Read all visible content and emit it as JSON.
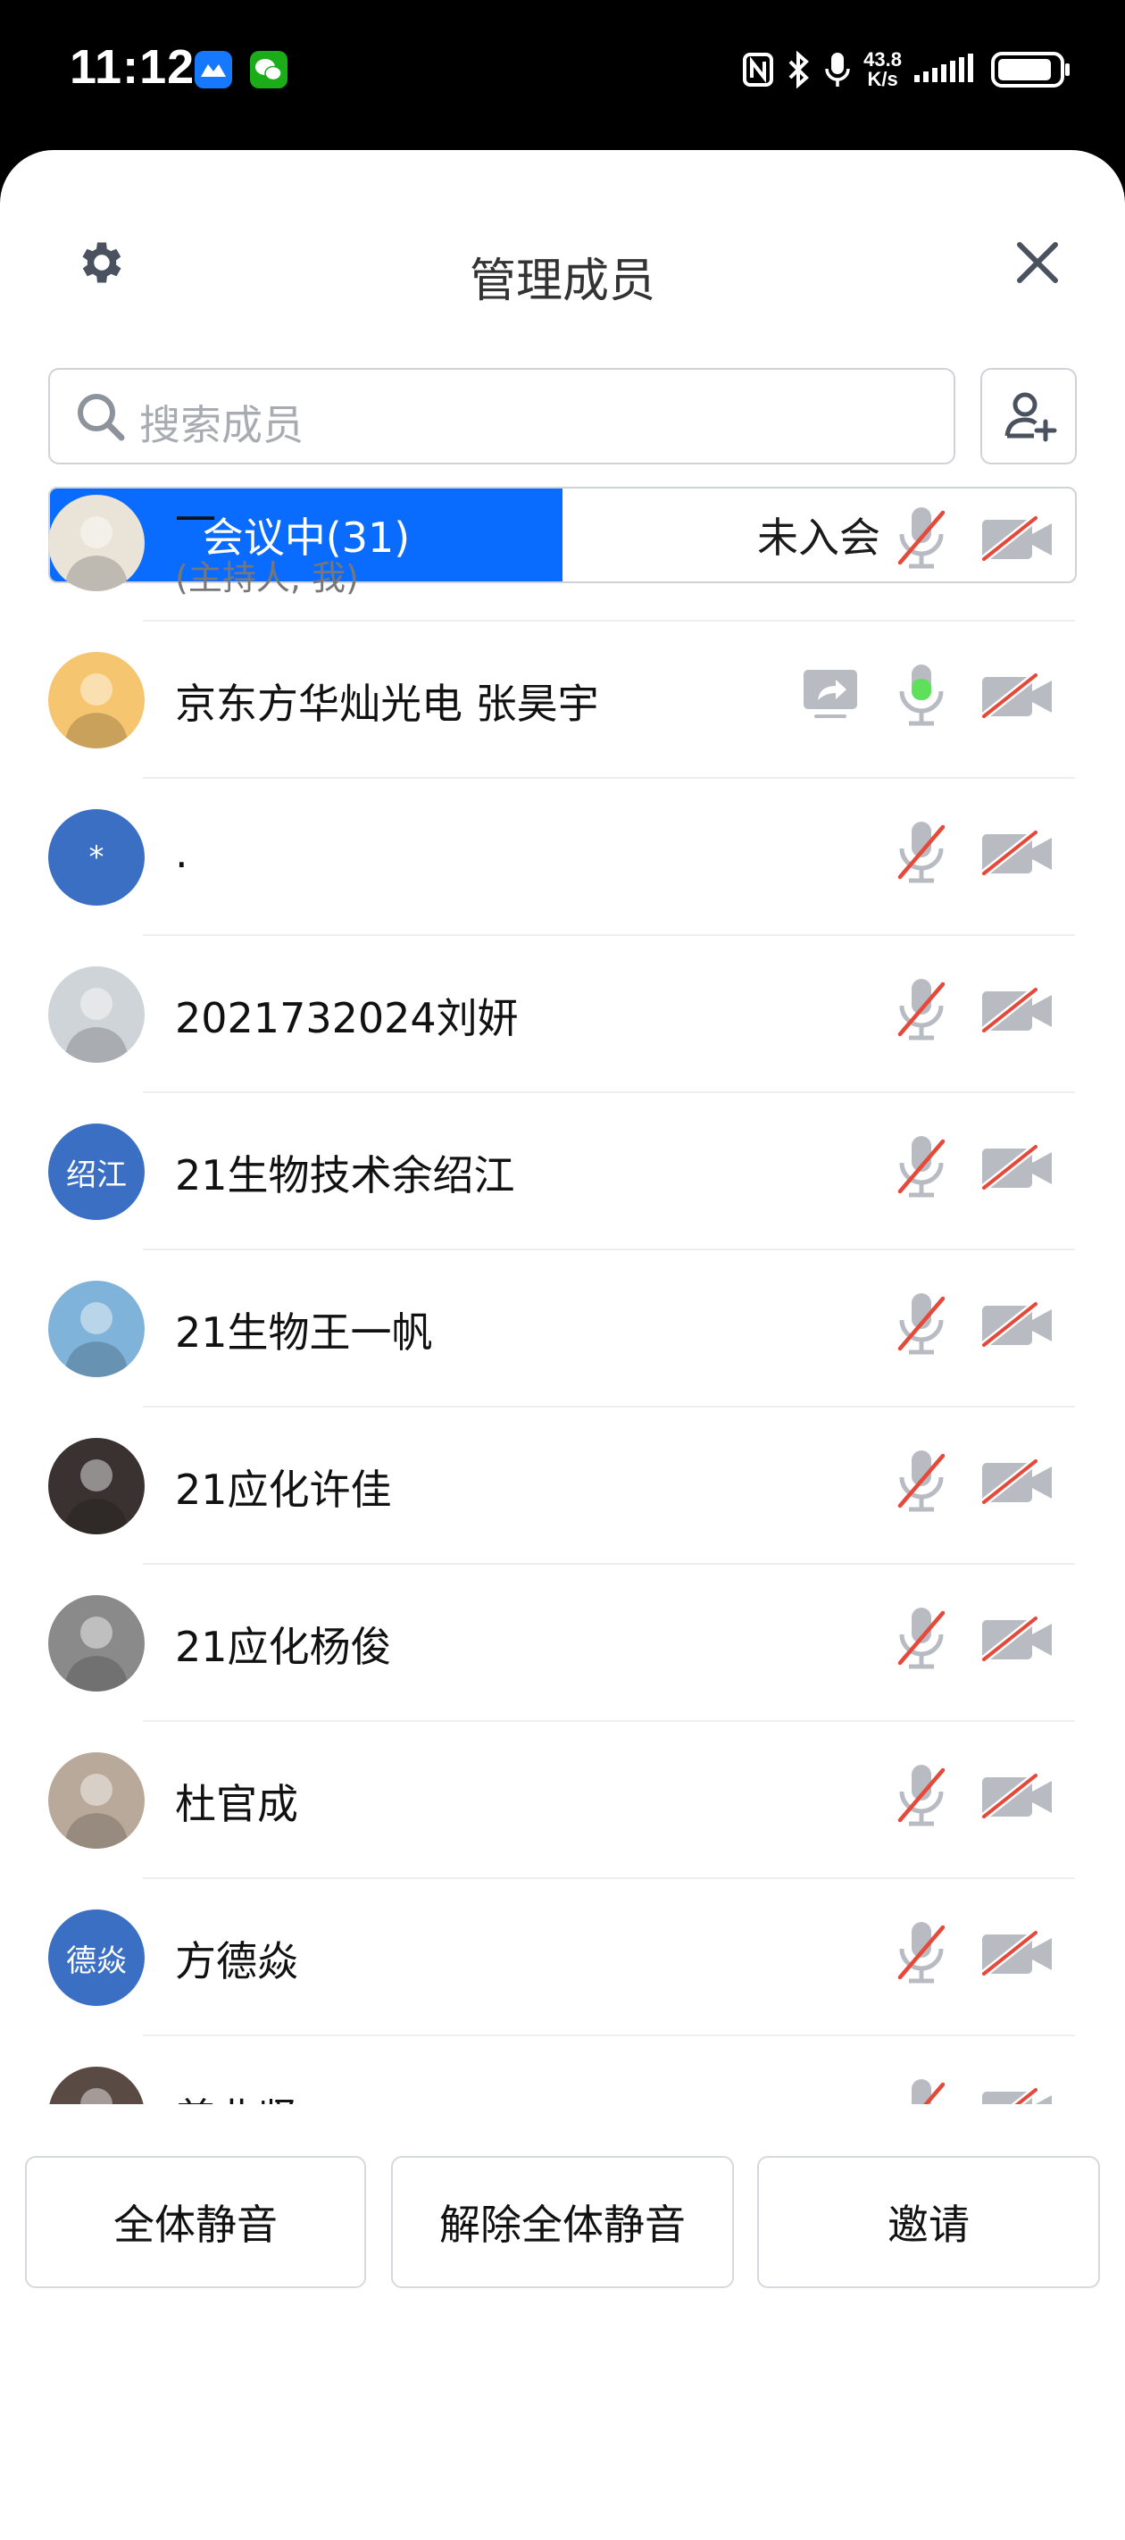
{
  "status_bar": {
    "time": "11:12",
    "net_speed_value": "43.8",
    "net_speed_unit": "K/s",
    "battery_level": 0.9
  },
  "header": {
    "title": "管理成员"
  },
  "search": {
    "placeholder": "搜索成员"
  },
  "tabs": [
    {
      "label": "会议中(31)",
      "active": true
    },
    {
      "label": "未入会",
      "active": false
    }
  ],
  "members": [
    {
      "name": "一",
      "role": "(主持人, 我)",
      "avatar": "photo",
      "avatar_color": "#e9e3d8",
      "mic": "muted",
      "camera": "off",
      "sharing": false
    },
    {
      "name": "京东方华灿光电 张昊宇",
      "role": "",
      "avatar": "photo",
      "avatar_color": "#f6c56f",
      "mic": "active",
      "camera": "off",
      "sharing": true
    },
    {
      "name": ".",
      "role": "",
      "avatar": "*",
      "avatar_color": "#3b6fc4",
      "mic": "muted",
      "camera": "off",
      "sharing": false
    },
    {
      "name": "2021732024刘妍",
      "role": "",
      "avatar": "photo",
      "avatar_color": "#cfd4d8",
      "mic": "muted",
      "camera": "off",
      "sharing": false
    },
    {
      "name": "21生物技术余绍江",
      "role": "",
      "avatar": "绍江",
      "avatar_color": "#3b6fc4",
      "mic": "muted",
      "camera": "off",
      "sharing": false
    },
    {
      "name": "21生物王一帆",
      "role": "",
      "avatar": "photo",
      "avatar_color": "#7fb3d9",
      "mic": "muted",
      "camera": "off",
      "sharing": false
    },
    {
      "name": "21应化许佳",
      "role": "",
      "avatar": "photo",
      "avatar_color": "#3a3230",
      "mic": "muted",
      "camera": "off",
      "sharing": false
    },
    {
      "name": "21应化杨俊",
      "role": "",
      "avatar": "photo",
      "avatar_color": "#8a8a8a",
      "mic": "muted",
      "camera": "off",
      "sharing": false
    },
    {
      "name": "杜官成",
      "role": "",
      "avatar": "photo",
      "avatar_color": "#b9a99a",
      "mic": "muted",
      "camera": "off",
      "sharing": false
    },
    {
      "name": "方德焱",
      "role": "",
      "avatar": "德焱",
      "avatar_color": "#3b6fc4",
      "mic": "muted",
      "camera": "off",
      "sharing": false
    },
    {
      "name": "姜业坚",
      "role": "",
      "avatar": "photo",
      "avatar_color": "#5a4a44",
      "mic": "muted",
      "camera": "off",
      "sharing": false
    }
  ],
  "actions": {
    "mute_all": "全体静音",
    "unmute_all": "解除全体静音",
    "invite": "邀请"
  },
  "colors": {
    "accent": "#0a6cff",
    "muted_slash": "#e5493a",
    "active_mic": "#5ee05a",
    "avatar_blue": "#3b6fc4"
  },
  "icons": {
    "settings": "gear-icon",
    "close": "close-icon",
    "search": "search-icon",
    "add_member": "add-user-icon",
    "mic_muted": "mic-muted-icon",
    "mic_active": "mic-active-icon",
    "camera_off": "camera-off-icon",
    "screen_share": "screen-share-icon"
  }
}
